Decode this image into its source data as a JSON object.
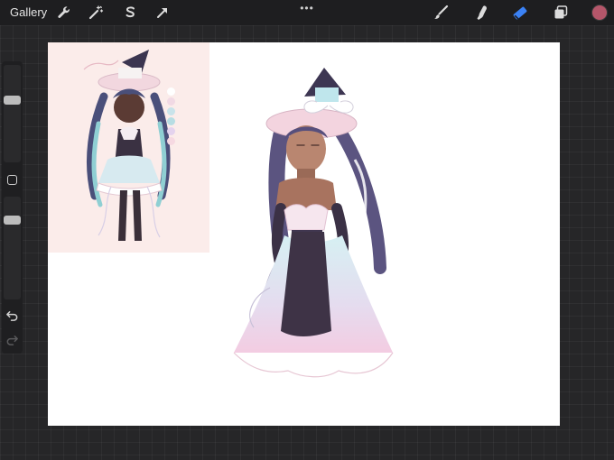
{
  "toolbar": {
    "gallery_label": "Gallery",
    "more_glyph": "•••",
    "left_tools": [
      {
        "name": "actions",
        "icon": "wrench-icon"
      },
      {
        "name": "adjustments",
        "icon": "magic-wand-icon"
      },
      {
        "name": "selection",
        "icon": "selection-s-icon"
      },
      {
        "name": "transform",
        "icon": "arrow-cursor-icon"
      }
    ],
    "right_tools": [
      {
        "name": "brush",
        "icon": "brush-icon"
      },
      {
        "name": "smudge",
        "icon": "smudge-finger-icon"
      },
      {
        "name": "eraser",
        "icon": "eraser-icon",
        "active": true
      },
      {
        "name": "layers",
        "icon": "layers-icon"
      }
    ],
    "current_color": "#b5566a",
    "accent_color": "#3b82f6"
  },
  "sidebar": {
    "brush_size_level": 0.35,
    "opacity_level": 0.2,
    "modify_button_icon": "square-icon",
    "undo_icon": "undo-icon",
    "redo_icon": "redo-icon"
  },
  "reference_palette": [
    "#ffffff",
    "#f1d9e4",
    "#c9e3ea",
    "#b7dde3",
    "#e4d3ee",
    "#f6d9e2"
  ]
}
